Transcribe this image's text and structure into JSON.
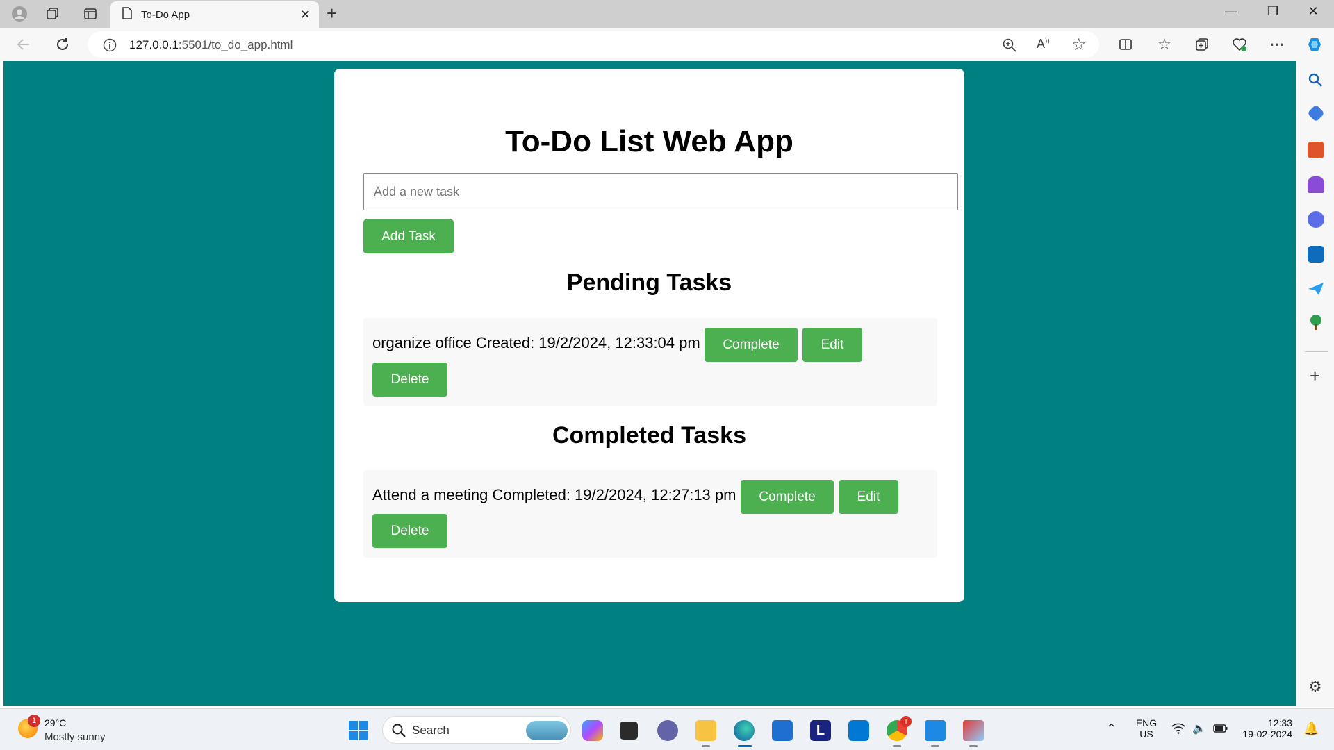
{
  "browser": {
    "tab_title": "To-Do App",
    "url_host": "127.0.0.1",
    "url_path": ":5501/to_do_app.html",
    "icons": [
      "profile-icon",
      "collections-icon",
      "tab-actions-icon",
      "page-icon",
      "close-icon",
      "new-tab-icon",
      "back-icon",
      "refresh-icon",
      "info-icon",
      "zoom-icon",
      "read-aloud-icon",
      "favorite-star-icon",
      "split-screen-icon",
      "favorites-icon",
      "collections-icon",
      "browser-essentials-icon",
      "more-icon",
      "copilot-icon"
    ]
  },
  "app": {
    "title": "To-Do List Web App",
    "input_placeholder": "Add a new task",
    "input_value": "",
    "add_button": "Add Task",
    "pending_heading": "Pending Tasks",
    "completed_heading": "Completed Tasks",
    "pending_tasks": [
      {
        "text": "organize office Created: 19/2/2024, 12:33:04 pm",
        "complete_label": "Complete",
        "edit_label": "Edit",
        "delete_label": "Delete"
      }
    ],
    "completed_tasks": [
      {
        "text": "Attend a meeting Completed: 19/2/2024, 12:27:13 pm",
        "complete_label": "Complete",
        "edit_label": "Edit",
        "delete_label": "Delete"
      }
    ],
    "colors": {
      "page_bg": "#008080",
      "card_bg": "#ffffff",
      "button_bg": "#4caf50",
      "button_text": "#ffffff",
      "task_bg": "#f8f8f8"
    }
  },
  "taskbar": {
    "weather_badge": "1",
    "weather_temp": "29°C",
    "weather_condition": "Mostly sunny",
    "search_label": "Search",
    "language": "ENG",
    "region": "US",
    "time": "12:33",
    "date": "19-02-2024",
    "chrome_badge": "T",
    "store_letter": "L"
  }
}
